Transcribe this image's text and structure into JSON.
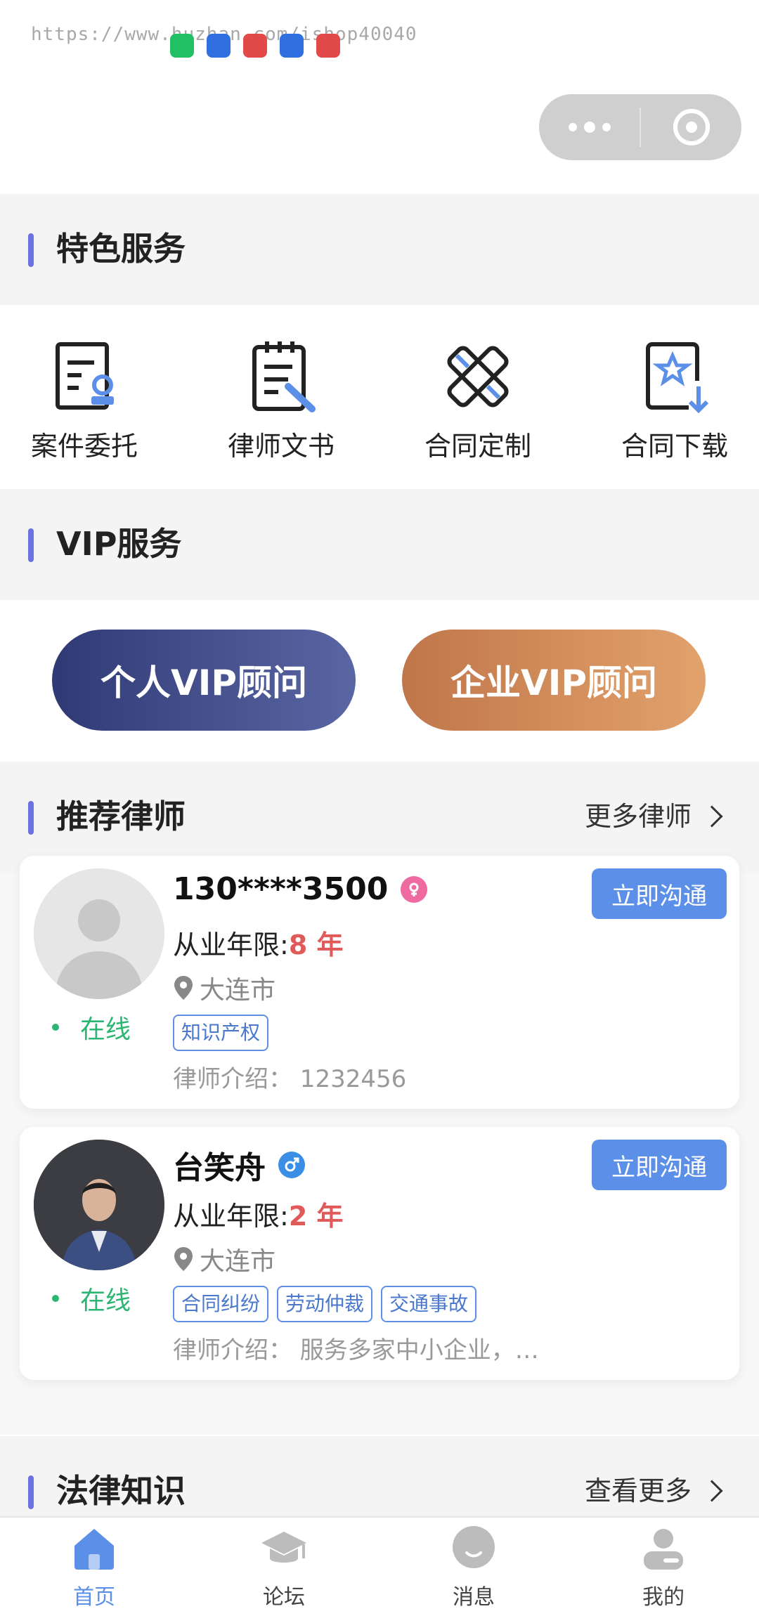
{
  "status": {
    "watermark": "https://www.huzhan.com/ishop40040",
    "icon_colors": [
      "#21c064",
      "#2f6fe0",
      "#e24a4a",
      "#2f6fe0",
      "#e24a4a"
    ]
  },
  "capsule": {
    "menu_icon": "more-dots-icon",
    "close_icon": "target-icon"
  },
  "features_section": {
    "title": "特色服务"
  },
  "features": [
    {
      "label": "案件委托",
      "icon": "case-entrust-icon"
    },
    {
      "label": "律师文书",
      "icon": "lawyer-document-icon"
    },
    {
      "label": "合同定制",
      "icon": "contract-custom-icon"
    },
    {
      "label": "合同下载",
      "icon": "contract-download-icon"
    }
  ],
  "vip_section": {
    "title": "VIP服务"
  },
  "vip": {
    "personal": "个人VIP顾问",
    "enterprise": "企业VIP顾问"
  },
  "lawyers_section": {
    "title": "推荐律师",
    "more": "更多律师"
  },
  "lawyers": [
    {
      "name": "130****3500",
      "gender": "female",
      "exp_label": "从业年限:",
      "exp_value": "8 年",
      "city": "大连市",
      "status": "在线",
      "tags": [
        "知识产权"
      ],
      "intro": "律师介绍：  1232456",
      "action": "立即沟通"
    },
    {
      "name": "台笑舟",
      "gender": "male",
      "exp_label": "从业年限:",
      "exp_value": "2 年",
      "city": "大连市",
      "status": "在线",
      "tags": [
        "合同纠纷",
        "劳动仲裁",
        "交通事故"
      ],
      "intro": "律师介绍：  服务多家中小企业，…",
      "action": "立即沟通"
    }
  ],
  "law_section": {
    "title": "法律知识",
    "more": "查看更多"
  },
  "tabbar": [
    {
      "label": "首页",
      "icon": "home-icon",
      "active": true
    },
    {
      "label": "论坛",
      "icon": "graduation-cap-icon",
      "active": false
    },
    {
      "label": "消息",
      "icon": "message-icon",
      "active": false
    },
    {
      "label": "我的",
      "icon": "user-icon",
      "active": false
    }
  ],
  "colors": {
    "accent": "#5b8fe8",
    "section_bar": "#6a72e0",
    "online": "#2bb673",
    "years": "#e05a5a"
  }
}
